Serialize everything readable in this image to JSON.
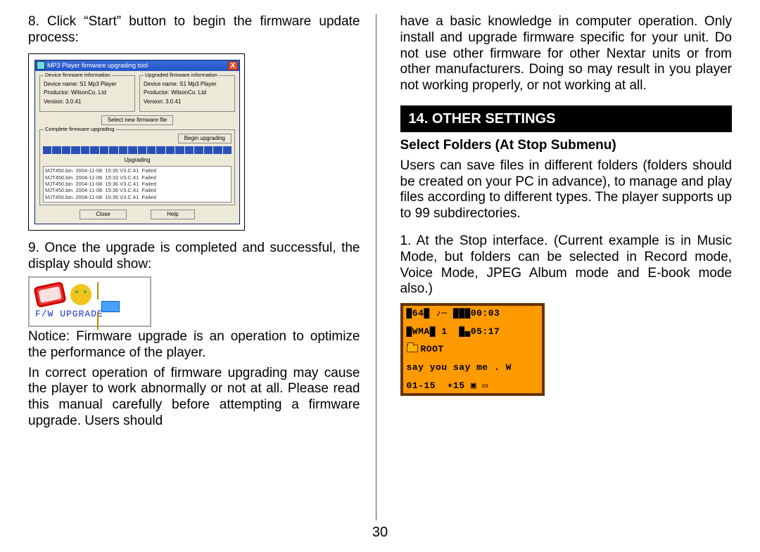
{
  "page_number": "30",
  "left": {
    "step8": "8. Click “Start”  button to begin the firmware update process:",
    "step9": "9. Once the upgrade is completed and successful, the display should show:",
    "notice1": "Notice: Firmware upgrade is an operation to optimize the performance of the player.",
    "notice2": "In correct operation of firmware upgrading may cause the player to work abnormally or not at all.  Please read this manual carefully before attempting a firmware upgrade. Users should"
  },
  "right": {
    "cont": "have a basic knowledge in computer operation.  Only install and upgrade firmware specific for your unit.  Do not use other firmware for other Nextar units or from other manufacturers.  Doing so may result in you player not working properly, or not working at all.",
    "header": "14. OTHER SETTINGS",
    "subhead": "Select Folders (At Stop Submenu)",
    "para2": "Users can save files in different folders (folders should be created on your PC in advance), to manage and play files according to different types. The player supports up to 99 subdirectories.",
    "para3": "1. At the Stop interface. (Current example is in Music Mode, but folders can be selected in Record mode, Voice Mode, JPEG Album mode and E-book mode also.)"
  },
  "dialog": {
    "title": "MP3 Player firmware upgrading tool",
    "left_fs": {
      "legend": "Device firmware information",
      "r1": "Device name: S1 Mp3 Player",
      "r2": "Productor: WilsonCo. Ltd",
      "r3": "Version: 3.0.41"
    },
    "right_fs": {
      "legend": "Upgraded firmware information",
      "r1": "Device name: S1 Mp3 Player",
      "r2": "Productor: WilsonCo. Ltd",
      "r3": "Version: 3.0.41"
    },
    "select_btn": "Select new firmware file",
    "progress_legend": "Complete firmware upgrading",
    "begin_btn": "Begin upgrading",
    "upgrading": "Upgrading",
    "list": "MJT450.bin  2004-11-08  15:35 V3.C.41  Failed\nMJT450.bin  2004-11-08  15:33 V3.C.41  Failed\nMJT450.bin  2004-11-08  15:36 V3.C.41  Failed\nMJT450.bin  2004-11-08  15:36 V3.C.41  Failed\nMJT450.bin  2004-11-08  15:35 V3.C.41  Failed",
    "close_btn": "Close",
    "help_btn": "Help"
  },
  "badge": {
    "text": "F/W UPGRADE"
  },
  "lcd": {
    "l1": "█64█ ♪─ ███00:03",
    "l2": "█WMA█ 1  █▄05:17",
    "root": "ROOT",
    "song": "say you say me . W",
    "l5": "01-15  ✶15 ▣ ▭"
  }
}
